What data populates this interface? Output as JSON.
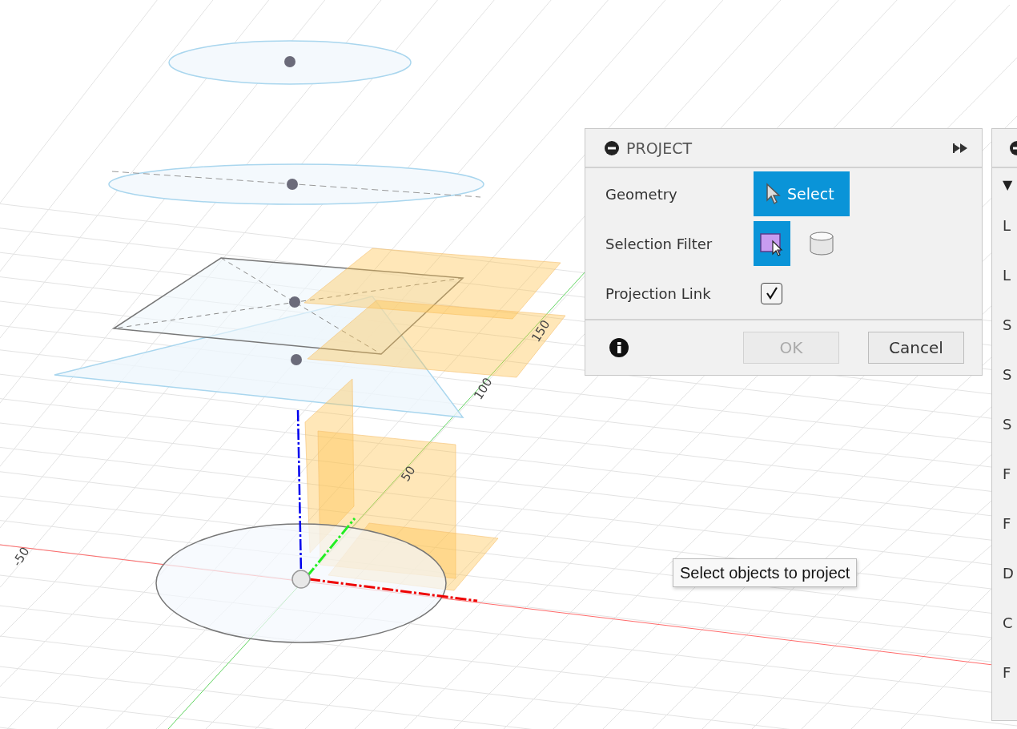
{
  "canvas": {
    "axis_labels": [
      {
        "text": "150",
        "kind": "y"
      },
      {
        "text": "100",
        "kind": "y"
      },
      {
        "text": "50",
        "kind": "y"
      },
      {
        "text": "-50",
        "kind": "x"
      }
    ]
  },
  "dialog": {
    "title": "PROJECT",
    "rows": [
      {
        "kind": "button",
        "label": "Geometry",
        "button": "Select",
        "selected": true
      },
      {
        "kind": "filter",
        "label": "Selection Filter",
        "filters": [
          {
            "kind": "sketch",
            "selected": true
          },
          {
            "kind": "body",
            "selected": false
          }
        ]
      },
      {
        "kind": "checkbox",
        "label": "Projection Link",
        "checked": true
      }
    ],
    "buttons": [
      {
        "label": "OK",
        "disabled": true
      },
      {
        "label": "Cancel",
        "disabled": false
      }
    ]
  },
  "tooltip": "Select objects to project",
  "side_panel": {
    "items": [
      {
        "text": "▼",
        "kind": "caret"
      },
      {
        "text": "L"
      },
      {
        "text": "L"
      },
      {
        "text": "S"
      },
      {
        "text": "S"
      },
      {
        "text": "S"
      },
      {
        "text": "F"
      },
      {
        "text": "F"
      },
      {
        "text": "D"
      },
      {
        "text": "C"
      },
      {
        "text": "F"
      }
    ]
  }
}
